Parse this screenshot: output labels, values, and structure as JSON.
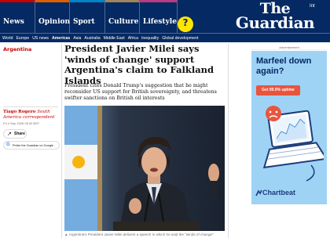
{
  "header": {
    "pillars": [
      {
        "label": "News",
        "color": "#c70000"
      },
      {
        "label": "Opinion",
        "color": "#e05e00"
      },
      {
        "label": "Sport",
        "color": "#0084c6"
      },
      {
        "label": "Culture",
        "color": "#a1845c"
      },
      {
        "label": "Lifestyle",
        "color": "#bb3b80"
      }
    ],
    "help_icon": "?",
    "edition": "Int",
    "logo_the": "The",
    "logo_guardian": "Guardian",
    "brand_color": "#052962"
  },
  "subnav": {
    "items": [
      "World",
      "Europe",
      "US news",
      "Americas",
      "Asia",
      "Australia",
      "Middle East",
      "Africa",
      "Inequality",
      "Global development"
    ],
    "active": "Americas"
  },
  "article": {
    "section": "Argentina",
    "headline": "President Javier Milei says 'winds of change' support Argentina's claim to Falkland Islands",
    "standfirst": "President cites Donald Trump's suggestion that he might reconsider US support for British sovereignty, and threatens swifter sanctions on British oil interests",
    "author_name": "Tiago Rogero",
    "author_role": "South America correspondent",
    "dateline": "Fri 4 Sep 2026 06.00 BST",
    "share_label": "Share",
    "prefer_label": "Prefer the Guardian on Google",
    "caption": "▲ Argentina's President Javier Milei delivers a speech in which he said the \"winds of change\""
  },
  "ad": {
    "label": "Advertisement",
    "headline": "Marfeel down again?",
    "cta": "Get 99.9% uptime",
    "brand": "Chartbeat",
    "bg_color": "#9ed3f6",
    "cta_color": "#e8553e"
  }
}
